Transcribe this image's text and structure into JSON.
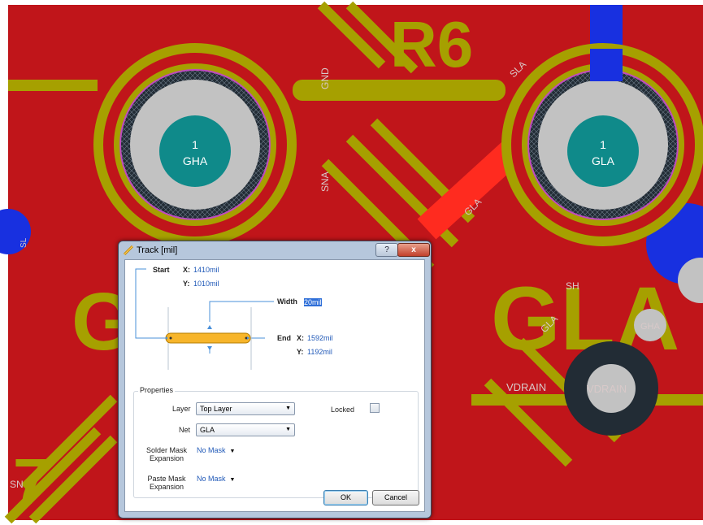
{
  "pcb": {
    "designators": [
      "R6",
      "GLA",
      "G",
      "7"
    ],
    "pad_numbers": [
      "1",
      "1"
    ],
    "pad_nets": [
      "GHA",
      "GLA"
    ],
    "net_labels": [
      "GND",
      "SLA",
      "SNA",
      "GLA",
      "SH",
      "GHA",
      "VDRAIN",
      "VDRAIN",
      "SN",
      "GLA",
      "SL"
    ],
    "colors": {
      "board": "#c0151a",
      "silkscreen": "#a6a000",
      "pad": "#c2c2c2",
      "pad_center": "#0f8a8a",
      "selected_track": "#ff2b1f",
      "bottom_layer": "#1830e0",
      "keepout": "#222c35",
      "via_ring": "#c04ac0"
    }
  },
  "dialog": {
    "title": "Track [mil]",
    "help_label": "?",
    "close_label": "x",
    "start": {
      "label": "Start",
      "x_label": "X:",
      "x_value": "1410mil",
      "y_label": "Y:",
      "y_value": "1010mil"
    },
    "width": {
      "label": "Width",
      "value": "20mil"
    },
    "end": {
      "label": "End",
      "x_label": "X:",
      "x_value": "1592mil",
      "y_label": "Y:",
      "y_value": "1192mil"
    },
    "properties": {
      "group_label": "Properties",
      "layer_label": "Layer",
      "layer_value": "Top Layer",
      "locked_label": "Locked",
      "locked_checked": false,
      "net_label": "Net",
      "net_value": "GLA",
      "solder_mask_label_1": "Solder Mask",
      "solder_mask_label_2": "Expansion",
      "solder_mask_value": "No Mask",
      "paste_mask_label_1": "Paste Mask",
      "paste_mask_label_2": "Expansion",
      "paste_mask_value": "No Mask"
    },
    "ok_label": "OK",
    "cancel_label": "Cancel",
    "track_color": "#f7b52a"
  }
}
